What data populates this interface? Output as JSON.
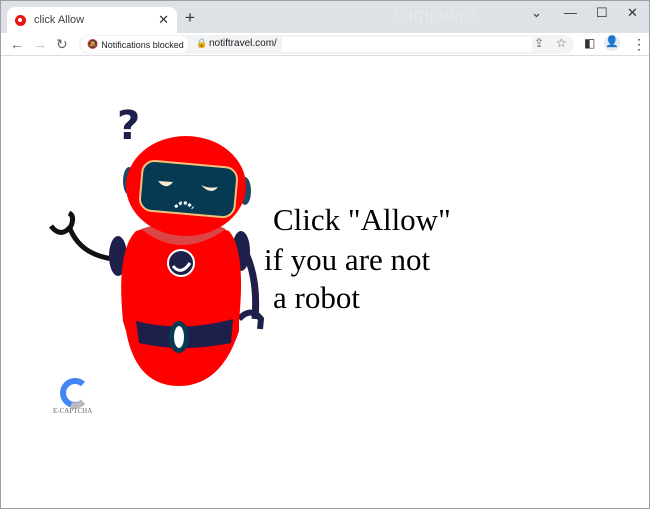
{
  "browser": {
    "tab_title": "click Allow",
    "watermark": "computips",
    "notification_chip": "Notifications blocked",
    "url": "notiftravel.com/"
  },
  "page": {
    "line1": "Click \"Allow\"",
    "line2": "if you are not",
    "line3": "a robot",
    "logo_text": "E-CAPTCHA"
  },
  "colors": {
    "robot_red": "#ff0000",
    "robot_navy": "#1e1f4b",
    "visor": "#063a52"
  }
}
